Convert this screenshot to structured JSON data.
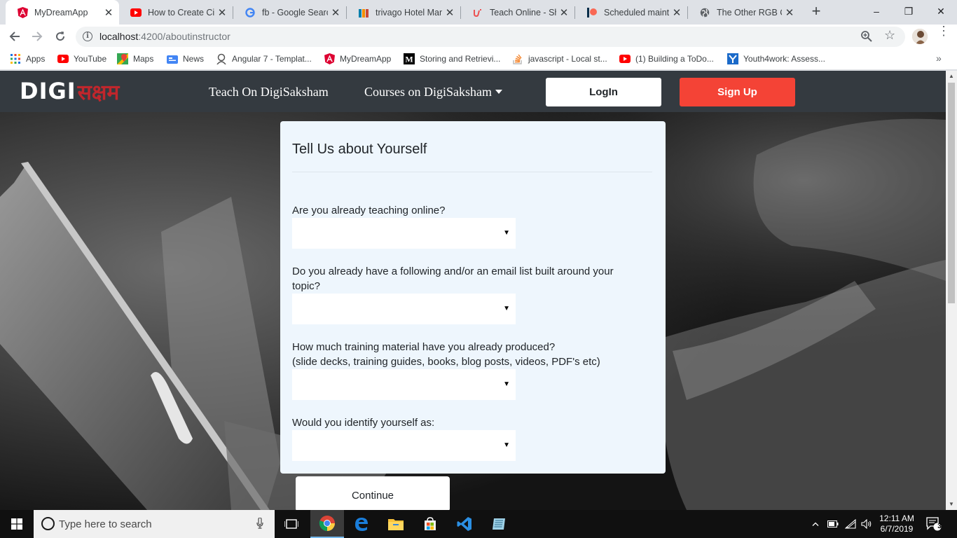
{
  "browser": {
    "tabs": [
      {
        "title": "MyDreamApp",
        "favicon": "angular-icon",
        "active": true
      },
      {
        "title": "How to Create Circ",
        "favicon": "youtube-icon"
      },
      {
        "title": "fb - Google Search",
        "favicon": "google-icon"
      },
      {
        "title": "trivago Hotel Man",
        "favicon": "trivago-icon"
      },
      {
        "title": "Teach Online - Sha",
        "favicon": "udemy-icon"
      },
      {
        "title": "Scheduled mainte",
        "favicon": "patreon-icon"
      },
      {
        "title": "The Other RGB Co",
        "favicon": "globe-icon"
      }
    ],
    "new_tab": "+",
    "window_controls": {
      "minimize": "–",
      "restore": "❐",
      "close": "✕"
    },
    "address": {
      "host": "localhost",
      "rest": ":4200/aboutinstructor"
    },
    "bookmarks": [
      {
        "label": "Apps",
        "icon": "apps-grid-icon"
      },
      {
        "label": "YouTube",
        "icon": "youtube-icon"
      },
      {
        "label": "Maps",
        "icon": "maps-icon"
      },
      {
        "label": "News",
        "icon": "news-icon"
      },
      {
        "label": "Angular 7 - Templat...",
        "icon": "angular-templates-icon"
      },
      {
        "label": "MyDreamApp",
        "icon": "angular-icon"
      },
      {
        "label": "Storing and Retrievi...",
        "icon": "medium-icon"
      },
      {
        "label": "javascript - Local st...",
        "icon": "stackoverflow-icon"
      },
      {
        "label": "(1) Building a ToDo...",
        "icon": "youtube-icon"
      },
      {
        "label": "Youth4work: Assess...",
        "icon": "youth4work-icon"
      }
    ],
    "bookmarks_more": "»"
  },
  "site": {
    "logo": {
      "latin": "DIGI",
      "devanagari": "सक्षम"
    },
    "nav": {
      "teach": "Teach On DigiSaksham",
      "courses": "Courses on DigiSaksham",
      "login": "LogIn",
      "signup": "Sign Up"
    },
    "colors": {
      "navbar": "#343a40",
      "signup": "#f44336",
      "card": "#eef6fd"
    }
  },
  "form": {
    "title": "Tell Us about Yourself",
    "questions": [
      {
        "label": "Are you already teaching online?",
        "value": ""
      },
      {
        "label": "Do you already have a following and/or an email list built around your topic?",
        "value": ""
      },
      {
        "label": "How much training material have you already produced?",
        "sublabel": "(slide decks, training guides, books, blog posts, videos, PDF's etc)",
        "value": ""
      },
      {
        "label": "Would you identify yourself as:",
        "value": ""
      }
    ],
    "continue": "Continue"
  },
  "taskbar": {
    "search_placeholder": "Type here to search",
    "time": "12:11 AM",
    "date": "6/7/2019",
    "notification_count": "3"
  }
}
